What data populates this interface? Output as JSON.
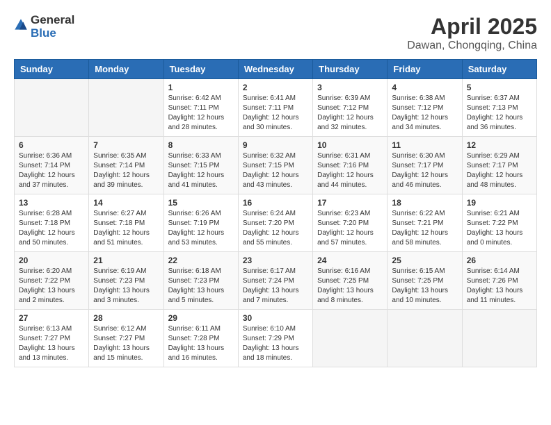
{
  "header": {
    "logo_general": "General",
    "logo_blue": "Blue",
    "month_year": "April 2025",
    "location": "Dawan, Chongqing, China"
  },
  "weekdays": [
    "Sunday",
    "Monday",
    "Tuesday",
    "Wednesday",
    "Thursday",
    "Friday",
    "Saturday"
  ],
  "weeks": [
    [
      {
        "day": "",
        "info": ""
      },
      {
        "day": "",
        "info": ""
      },
      {
        "day": "1",
        "info": "Sunrise: 6:42 AM\nSunset: 7:11 PM\nDaylight: 12 hours and 28 minutes."
      },
      {
        "day": "2",
        "info": "Sunrise: 6:41 AM\nSunset: 7:11 PM\nDaylight: 12 hours and 30 minutes."
      },
      {
        "day": "3",
        "info": "Sunrise: 6:39 AM\nSunset: 7:12 PM\nDaylight: 12 hours and 32 minutes."
      },
      {
        "day": "4",
        "info": "Sunrise: 6:38 AM\nSunset: 7:12 PM\nDaylight: 12 hours and 34 minutes."
      },
      {
        "day": "5",
        "info": "Sunrise: 6:37 AM\nSunset: 7:13 PM\nDaylight: 12 hours and 36 minutes."
      }
    ],
    [
      {
        "day": "6",
        "info": "Sunrise: 6:36 AM\nSunset: 7:14 PM\nDaylight: 12 hours and 37 minutes."
      },
      {
        "day": "7",
        "info": "Sunrise: 6:35 AM\nSunset: 7:14 PM\nDaylight: 12 hours and 39 minutes."
      },
      {
        "day": "8",
        "info": "Sunrise: 6:33 AM\nSunset: 7:15 PM\nDaylight: 12 hours and 41 minutes."
      },
      {
        "day": "9",
        "info": "Sunrise: 6:32 AM\nSunset: 7:15 PM\nDaylight: 12 hours and 43 minutes."
      },
      {
        "day": "10",
        "info": "Sunrise: 6:31 AM\nSunset: 7:16 PM\nDaylight: 12 hours and 44 minutes."
      },
      {
        "day": "11",
        "info": "Sunrise: 6:30 AM\nSunset: 7:17 PM\nDaylight: 12 hours and 46 minutes."
      },
      {
        "day": "12",
        "info": "Sunrise: 6:29 AM\nSunset: 7:17 PM\nDaylight: 12 hours and 48 minutes."
      }
    ],
    [
      {
        "day": "13",
        "info": "Sunrise: 6:28 AM\nSunset: 7:18 PM\nDaylight: 12 hours and 50 minutes."
      },
      {
        "day": "14",
        "info": "Sunrise: 6:27 AM\nSunset: 7:18 PM\nDaylight: 12 hours and 51 minutes."
      },
      {
        "day": "15",
        "info": "Sunrise: 6:26 AM\nSunset: 7:19 PM\nDaylight: 12 hours and 53 minutes."
      },
      {
        "day": "16",
        "info": "Sunrise: 6:24 AM\nSunset: 7:20 PM\nDaylight: 12 hours and 55 minutes."
      },
      {
        "day": "17",
        "info": "Sunrise: 6:23 AM\nSunset: 7:20 PM\nDaylight: 12 hours and 57 minutes."
      },
      {
        "day": "18",
        "info": "Sunrise: 6:22 AM\nSunset: 7:21 PM\nDaylight: 12 hours and 58 minutes."
      },
      {
        "day": "19",
        "info": "Sunrise: 6:21 AM\nSunset: 7:22 PM\nDaylight: 13 hours and 0 minutes."
      }
    ],
    [
      {
        "day": "20",
        "info": "Sunrise: 6:20 AM\nSunset: 7:22 PM\nDaylight: 13 hours and 2 minutes."
      },
      {
        "day": "21",
        "info": "Sunrise: 6:19 AM\nSunset: 7:23 PM\nDaylight: 13 hours and 3 minutes."
      },
      {
        "day": "22",
        "info": "Sunrise: 6:18 AM\nSunset: 7:23 PM\nDaylight: 13 hours and 5 minutes."
      },
      {
        "day": "23",
        "info": "Sunrise: 6:17 AM\nSunset: 7:24 PM\nDaylight: 13 hours and 7 minutes."
      },
      {
        "day": "24",
        "info": "Sunrise: 6:16 AM\nSunset: 7:25 PM\nDaylight: 13 hours and 8 minutes."
      },
      {
        "day": "25",
        "info": "Sunrise: 6:15 AM\nSunset: 7:25 PM\nDaylight: 13 hours and 10 minutes."
      },
      {
        "day": "26",
        "info": "Sunrise: 6:14 AM\nSunset: 7:26 PM\nDaylight: 13 hours and 11 minutes."
      }
    ],
    [
      {
        "day": "27",
        "info": "Sunrise: 6:13 AM\nSunset: 7:27 PM\nDaylight: 13 hours and 13 minutes."
      },
      {
        "day": "28",
        "info": "Sunrise: 6:12 AM\nSunset: 7:27 PM\nDaylight: 13 hours and 15 minutes."
      },
      {
        "day": "29",
        "info": "Sunrise: 6:11 AM\nSunset: 7:28 PM\nDaylight: 13 hours and 16 minutes."
      },
      {
        "day": "30",
        "info": "Sunrise: 6:10 AM\nSunset: 7:29 PM\nDaylight: 13 hours and 18 minutes."
      },
      {
        "day": "",
        "info": ""
      },
      {
        "day": "",
        "info": ""
      },
      {
        "day": "",
        "info": ""
      }
    ]
  ]
}
